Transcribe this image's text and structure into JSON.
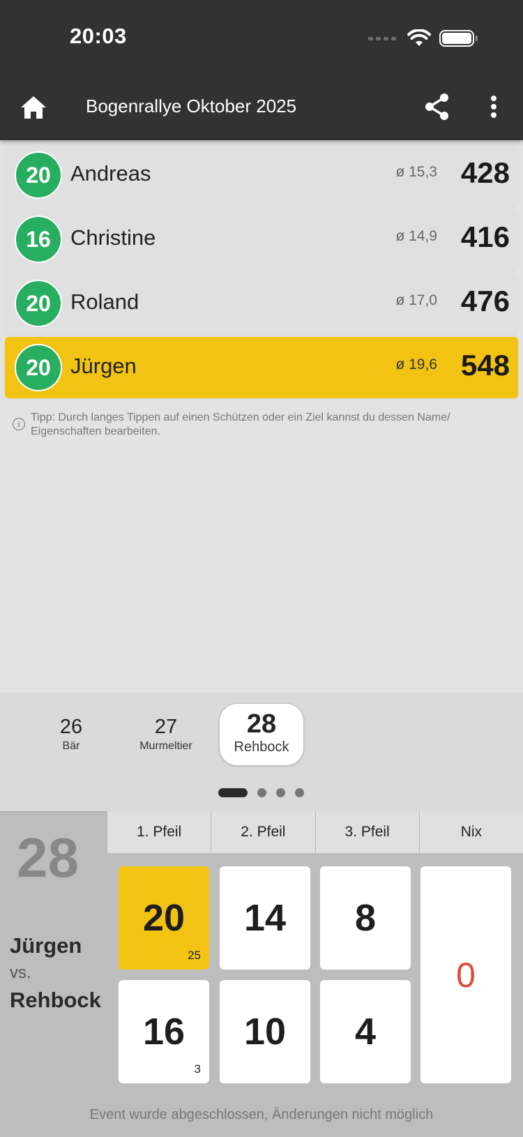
{
  "status": {
    "time": "20:03"
  },
  "appbar": {
    "title": "Bogenrallye Oktober 2025"
  },
  "shooters": [
    {
      "badge": "20",
      "name": "Andreas",
      "avg": "ø 15,3",
      "total": "428"
    },
    {
      "badge": "16",
      "name": "Christine",
      "avg": "ø 14,9",
      "total": "416"
    },
    {
      "badge": "20",
      "name": "Roland",
      "avg": "ø 17,0",
      "total": "476"
    },
    {
      "badge": "20",
      "name": "Jürgen",
      "avg": "ø 19,6",
      "total": "548"
    }
  ],
  "tip": "Tipp: Durch langes Tippen auf einen Schützen oder ein Ziel kannst du dessen Name/ Eigenschaften bearbeiten.",
  "targets": [
    {
      "num": "26",
      "label": "Bär"
    },
    {
      "num": "27",
      "label": "Murmeltier"
    },
    {
      "num": "28",
      "label": "Rehbock"
    }
  ],
  "scoring": {
    "target_number": "28",
    "shooter": "Jürgen",
    "vs": "vs.",
    "target_name": "Rehbock",
    "arrow_tabs": [
      "1. Pfeil",
      "2. Pfeil",
      "3. Pfeil",
      "Nix"
    ],
    "points": [
      {
        "value": "20",
        "sub": "25"
      },
      {
        "value": "14",
        "sub": ""
      },
      {
        "value": "8",
        "sub": ""
      },
      {
        "value": "16",
        "sub": "3"
      },
      {
        "value": "10",
        "sub": ""
      },
      {
        "value": "4",
        "sub": ""
      }
    ],
    "nix_value": "0"
  },
  "footer": "Event wurde abgeschlossen, Änderungen nicht möglich",
  "colors": {
    "appbar": "#323232",
    "accent": "#f2c312",
    "badge": "#27ae60",
    "miss": "#e04a3a"
  }
}
